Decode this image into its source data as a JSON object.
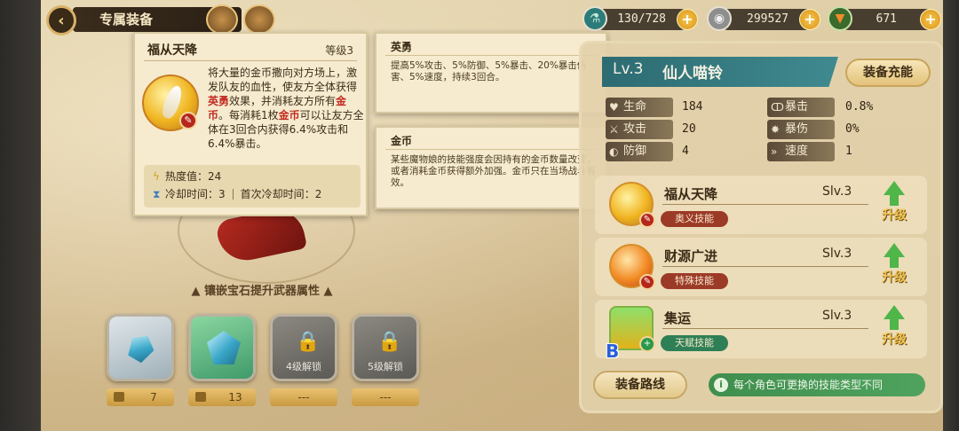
{
  "header": {
    "title": "专属装备",
    "resources": [
      {
        "icon": "energy-potion-icon",
        "value": "130/728"
      },
      {
        "icon": "silver-coin-icon",
        "value": "299527"
      },
      {
        "icon": "carrot-icon",
        "value": "671"
      }
    ]
  },
  "skill_tooltip": {
    "name": "福从天降",
    "level": "等级3",
    "desc_parts": [
      "将大量的金币撒向对方场上，激发队友的血性，使友方全体获得",
      "英勇",
      "效果，并消耗友方所有",
      "金币",
      "。每消耗1枚",
      "金币",
      "可以让友方全体在3回合内获得6.4%攻击和6.4%暴击。"
    ],
    "heat_label": "热度值",
    "heat_value": "24",
    "cooldown_label": "冷却时间",
    "cooldown_value": "3",
    "first_cooldown_label": "首次冷却时间",
    "first_cooldown_value": "2"
  },
  "keywords": [
    {
      "title": "英勇",
      "text": "提高5%攻击、5%防御、5%暴击、20%暴击伤害、5%速度，持续3回合。"
    },
    {
      "title": "金币",
      "text": "某些魔物娘的技能强度会因持有的金币数量改变，或者消耗金币获得额外加强。金币只在当场战斗有效。"
    }
  ],
  "gems": {
    "header": "镶嵌宝石提升武器属性",
    "slots": [
      {
        "state": "unlocked",
        "count": "7"
      },
      {
        "state": "unlocked",
        "count": "13"
      },
      {
        "state": "locked",
        "label": "4级解锁",
        "count": "---"
      },
      {
        "state": "locked",
        "label": "5级解锁",
        "count": "---"
      }
    ]
  },
  "hero": {
    "level": "Lv.3",
    "name": "仙人喵铃",
    "charge_button": "装备充能",
    "attributes": [
      {
        "icon": "heart-icon",
        "label": "生命",
        "value": "184"
      },
      {
        "icon": "crit-icon",
        "label": "暴击",
        "value": "0.8%"
      },
      {
        "icon": "sword-icon",
        "label": "攻击",
        "value": "20"
      },
      {
        "icon": "crit-damage-icon",
        "label": "暴伤",
        "value": "0%"
      },
      {
        "icon": "shield-icon",
        "label": "防御",
        "value": "4"
      },
      {
        "icon": "speed-icon",
        "label": "速度",
        "value": "1"
      }
    ]
  },
  "skills": [
    {
      "name": "福从天降",
      "level": "Slv.3",
      "type": "奥义技能",
      "upgrade": "升级"
    },
    {
      "name": "财源广进",
      "level": "Slv.3",
      "type": "特殊技能",
      "upgrade": "升级"
    },
    {
      "name": "集运",
      "level": "Slv.3",
      "type": "天赋技能",
      "upgrade": "升级",
      "letter": "B"
    }
  ],
  "footer": {
    "route_button": "装备路线",
    "tip": "每个角色可更换的技能类型不同"
  }
}
